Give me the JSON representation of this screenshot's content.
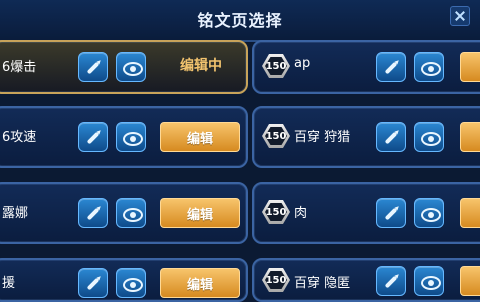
{
  "header": {
    "title": "铭文页选择"
  },
  "left_rows": [
    {
      "name": "6爆击",
      "status": "编辑中",
      "active": true
    },
    {
      "name": "6攻速",
      "button_label": "编辑"
    },
    {
      "name": "露娜",
      "button_label": "编辑"
    },
    {
      "name": "援",
      "button_label": "编辑"
    }
  ],
  "right_rows": [
    {
      "level": "150",
      "name": "ap"
    },
    {
      "level": "150",
      "name": "百穿 狩猎"
    },
    {
      "level": "150",
      "name": "肉"
    },
    {
      "level": "150",
      "name": "百穿 隐匿"
    }
  ],
  "icons": {
    "edit": "pencil-icon",
    "preview": "eye-icon"
  },
  "colors": {
    "accent_gold": "#d68a20",
    "active_border": "#c7a35a",
    "blue_button": "#2b87d2"
  }
}
